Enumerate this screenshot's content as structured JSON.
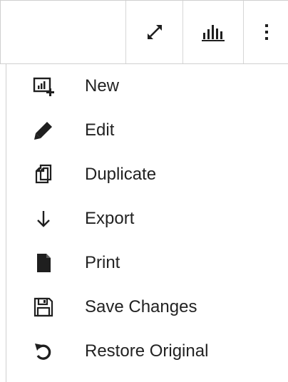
{
  "colors": {
    "icon": "#1f1f1f",
    "text": "#222222",
    "border": "#cfcfcf"
  },
  "toolbar": {
    "buttons": [
      {
        "name": "expand",
        "icon": "expand-diagonal-icon"
      },
      {
        "name": "chart",
        "icon": "bar-chart-icon"
      },
      {
        "name": "more",
        "icon": "more-vertical-icon"
      }
    ]
  },
  "menu": {
    "items": [
      {
        "label": "New",
        "icon": "new-chart-icon"
      },
      {
        "label": "Edit",
        "icon": "pencil-icon"
      },
      {
        "label": "Duplicate",
        "icon": "duplicate-icon"
      },
      {
        "label": "Export",
        "icon": "arrow-down-icon"
      },
      {
        "label": "Print",
        "icon": "document-icon"
      },
      {
        "label": "Save Changes",
        "icon": "floppy-disk-icon"
      },
      {
        "label": "Restore Original",
        "icon": "restore-icon"
      }
    ]
  }
}
